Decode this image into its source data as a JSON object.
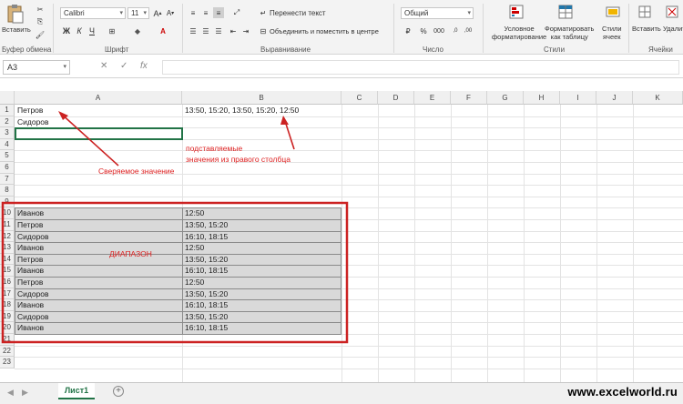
{
  "ribbon": {
    "clipboard": {
      "paste_label": "Вставить",
      "group_label": "Буфер обмена"
    },
    "font": {
      "name": "Calibri",
      "size": "11",
      "bold": "Ж",
      "italic": "К",
      "underline": "Ч",
      "group_label": "Шрифт"
    },
    "alignment": {
      "wrap_text": "Перенести текст",
      "merge_center": "Объединить и поместить в центре",
      "group_label": "Выравнивание"
    },
    "number": {
      "format": "Общий",
      "percent": "%",
      "thousands": "000",
      "group_label": "Число"
    },
    "styles": {
      "conditional_formatting": "Условное\nформатирование",
      "format_as_table": "Форматировать\nкак таблицу",
      "cell_styles": "Стили\nячеек",
      "group_label": "Стили"
    },
    "cells": {
      "insert_label": "Вставить",
      "delete_label": "Удалить",
      "group_label": "Ячейки"
    }
  },
  "formula_bar": {
    "name_box": "A3",
    "cancel": "✕",
    "enter": "✓",
    "fx": "fx",
    "content": ""
  },
  "columns": [
    "A",
    "B",
    "C",
    "D",
    "E",
    "F",
    "G",
    "H",
    "I",
    "J",
    "K"
  ],
  "rows": [
    "1",
    "2",
    "3",
    "4",
    "5",
    "6",
    "7",
    "8",
    "9",
    "10",
    "11",
    "12",
    "13",
    "14",
    "15",
    "16",
    "17",
    "18",
    "19",
    "20",
    "21",
    "22",
    "23"
  ],
  "cells": {
    "a1": "Петров",
    "a2": "Сидоров",
    "b1": "13:50, 15:20, 13:50, 15:20, 12:50",
    "table_a": [
      "Иванов",
      "Петров",
      "Сидоров",
      "Иванов",
      "Петров",
      "Иванов",
      "Петров",
      "Сидоров",
      "Иванов",
      "Сидоров",
      "Иванов"
    ],
    "table_b": [
      "12:50",
      "13:50, 15:20",
      "16:10, 18:15",
      "12:50",
      "13:50, 15:20",
      "16:10, 18:15",
      "12:50",
      "13:50, 15:20",
      "16:10, 18:15",
      "13:50, 15:20",
      "16:10, 18:15"
    ]
  },
  "annotations": {
    "compared_value": "Сверяемое значение",
    "substituted_1": "подставляемые",
    "substituted_2": "значения из правого столбца",
    "range": "ДИАПАЗОН"
  },
  "sheets": {
    "active": "Лист1",
    "add": "+"
  },
  "watermark": "www.excelworld.ru",
  "colors": {
    "accent": "#217346",
    "annotation": "#dd2222",
    "table_fill": "#d9d9d9"
  }
}
